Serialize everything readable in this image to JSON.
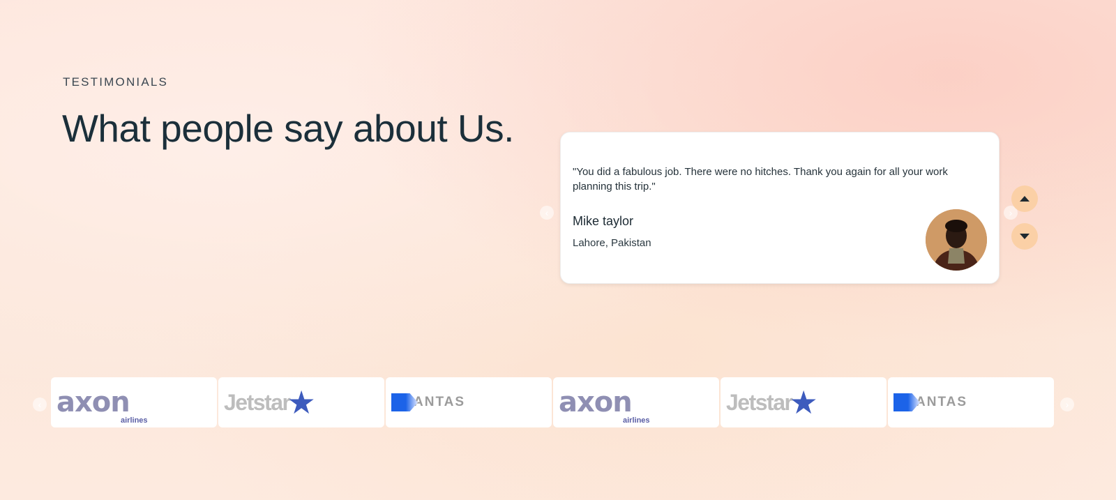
{
  "section": {
    "eyebrow": "TESTIMONIALS",
    "headline": "What people say about Us."
  },
  "testimonial": {
    "quote": "\"You did a fabulous job. There were no hitches. Thank you again for all your work planning this trip.\"",
    "author_name": "Mike taylor",
    "author_location": "Lahore, Pakistan",
    "avatar_icon": "person-photo"
  },
  "carousel_controls": {
    "prev_icon": "chevron-left-icon",
    "next_icon": "chevron-right-icon",
    "up_icon": "arrow-up-icon",
    "down_icon": "arrow-down-icon",
    "accent_color": "#fbd0a6"
  },
  "partners": {
    "logos": [
      {
        "name": "axon",
        "sub": "airlines"
      },
      {
        "name": "Jetstar",
        "sub": ""
      },
      {
        "name": "ANTAS",
        "sub": ""
      },
      {
        "name": "axon",
        "sub": "airlines"
      },
      {
        "name": "Jetstar",
        "sub": ""
      },
      {
        "name": "ANTAS",
        "sub": ""
      }
    ]
  },
  "colors": {
    "heading": "#1b2f3a",
    "star_blue": "#3d5bbd",
    "qantas_blue": "#1c63e8"
  }
}
